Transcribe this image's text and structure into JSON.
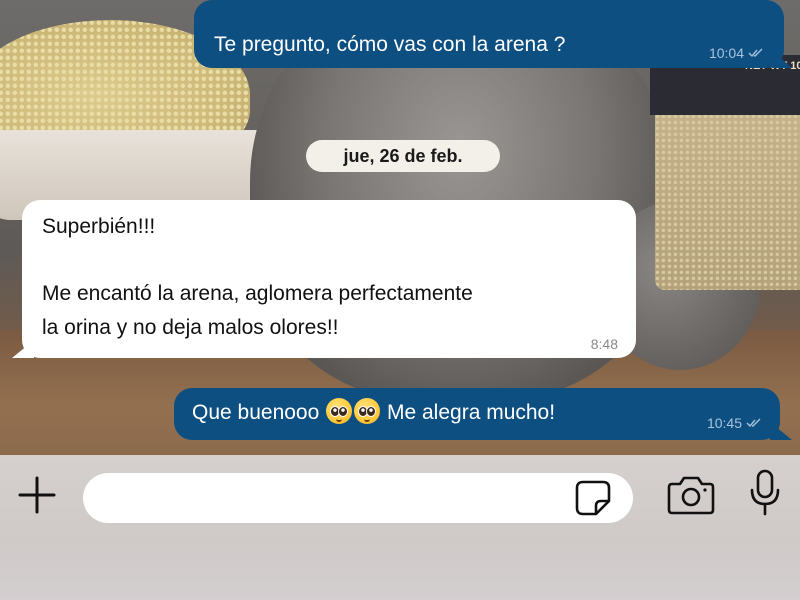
{
  "wallpaper": {
    "bag_text": "NET WT 10"
  },
  "messages": [
    {
      "direction": "outgoing",
      "text": "Te pregunto, cómo vas con la arena ?",
      "time": "10:04",
      "status_icon": "double-check-icon"
    },
    {
      "direction": "incoming",
      "line1": "Superbién!!!",
      "line2": "Me encantó la arena, aglomera perfectamente",
      "line3": "la orina y no deja malos olores!!",
      "time": "8:48"
    },
    {
      "direction": "outgoing",
      "text_before": "Que buenooo",
      "emojis": [
        "pleading-face",
        "pleading-face"
      ],
      "text_after": "Me alegra mucho!",
      "time": "10:45",
      "status_icon": "double-check-icon"
    }
  ],
  "date_separator": "jue, 26 de feb.",
  "composer": {
    "placeholder": "",
    "icons": [
      "plus-icon",
      "sticker-icon",
      "camera-icon",
      "microphone-icon"
    ]
  },
  "colors": {
    "outgoing_bubble": "#0e4f82",
    "incoming_bubble": "#ffffff",
    "input_bar": "#d2ccca"
  }
}
